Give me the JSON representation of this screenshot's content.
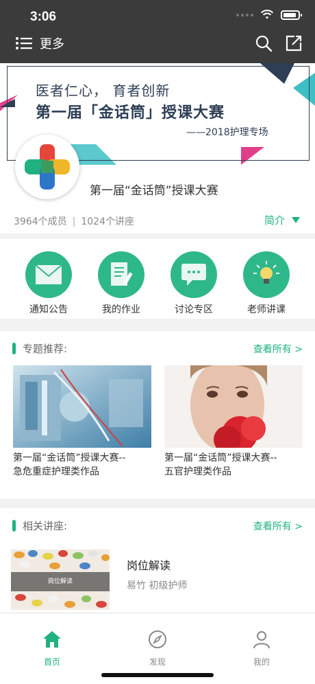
{
  "status_bar": {
    "time": "3:06"
  },
  "header": {
    "menu_label": "更多",
    "search_icon": "search-icon",
    "share_icon": "share-icon"
  },
  "banner": {
    "line1": "医者仁心，  育者创新",
    "line2": "第一届「金话筒」授课大赛",
    "line3": "——2018护理专场"
  },
  "course": {
    "title": "第一届“金话筒”授课大赛",
    "members": "3964个成员",
    "separator": "|",
    "lectures": "1024个讲座",
    "intro_label": "简介"
  },
  "actions": [
    {
      "label": "通知公告",
      "icon": "envelope-icon"
    },
    {
      "label": "我的作业",
      "icon": "document-pen-icon"
    },
    {
      "label": "讨论专区",
      "icon": "chat-bubble-icon"
    },
    {
      "label": "老师讲课",
      "icon": "lightbulb-icon"
    }
  ],
  "topics": {
    "title": "专题推荐:",
    "see_all": "查看所有 >",
    "items": [
      {
        "line1": "第一届“金话筒”授课大赛--",
        "line2": "急危重症护理类作品"
      },
      {
        "line1": "第一届“金话筒”授课大赛--",
        "line2": "五官护理类作品"
      }
    ]
  },
  "lectures": {
    "title": "相关讲座:",
    "see_all": "查看所有 >",
    "items": [
      {
        "thumb_text": "岗位解读",
        "name": "岗位解读",
        "meta": "易竹  初级护师"
      }
    ]
  },
  "tabbar": [
    {
      "label": "首页",
      "icon": "home-icon",
      "active": true
    },
    {
      "label": "发现",
      "icon": "compass-icon",
      "active": false
    },
    {
      "label": "我的",
      "icon": "user-icon",
      "active": false
    }
  ],
  "colors": {
    "accent": "#1fb17f",
    "topbar": "#3b3b3b",
    "banner_text": "#2d3e55"
  }
}
